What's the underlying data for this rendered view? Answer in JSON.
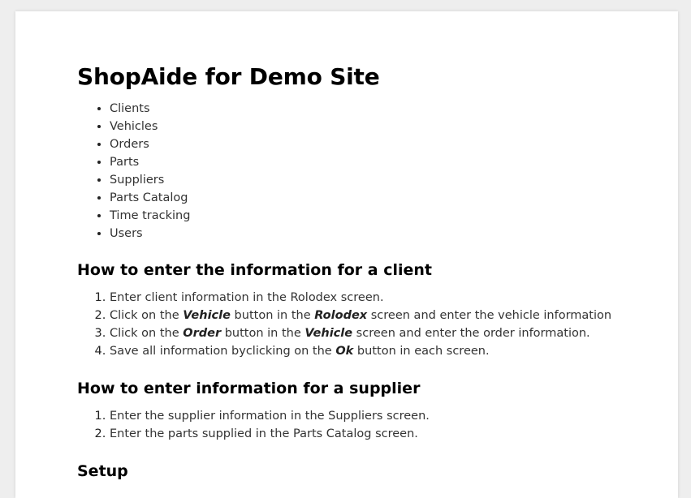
{
  "title": "ShopAide for Demo Site",
  "menu": [
    "Clients",
    "Vehicles",
    "Orders",
    "Parts",
    "Suppliers",
    "Parts Catalog",
    "Time tracking",
    "Users"
  ],
  "sections": [
    {
      "heading": "How to enter the information for a client",
      "steps": [
        {
          "t1": "Enter client information in the Rolodex screen."
        },
        {
          "t1": "Click on the ",
          "b1": "Vehicle",
          "t2": " button in the ",
          "b2": "Rolodex",
          "t3": " screen and enter the vehicle information"
        },
        {
          "t1": "Click on the ",
          "b1": "Order",
          "t2": " button in the ",
          "b2": "Vehicle",
          "t3": " screen and enter the order information."
        },
        {
          "t1": "Save all information byclicking on the ",
          "b1": "Ok",
          "t2": " button in each screen."
        }
      ]
    },
    {
      "heading": "How to enter information for a supplier",
      "steps": [
        {
          "t1": "Enter the supplier information in the Suppliers screen."
        },
        {
          "t1": "Enter the parts supplied in the Parts Catalog screen."
        }
      ]
    },
    {
      "heading": "Setup"
    }
  ]
}
